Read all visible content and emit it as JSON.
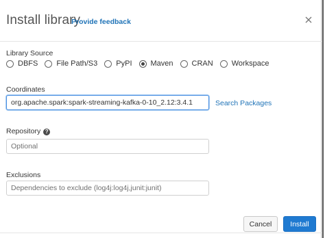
{
  "dialog": {
    "title": "Install library",
    "feedback_link": "Provide feedback",
    "close_icon": "close-icon"
  },
  "library_source": {
    "label": "Library Source",
    "options": [
      "DBFS",
      "File Path/S3",
      "PyPI",
      "Maven",
      "CRAN",
      "Workspace"
    ],
    "selected": "Maven"
  },
  "coordinates": {
    "label": "Coordinates",
    "value": "org.apache.spark:spark-streaming-kafka-0-10_2.12:3.4.1",
    "search_link": "Search Packages"
  },
  "repository": {
    "label": "Repository",
    "help_icon": "help-icon",
    "placeholder": "Optional"
  },
  "exclusions": {
    "label": "Exclusions",
    "placeholder": "Dependencies to exclude (log4j:log4j,junit:junit)"
  },
  "footer": {
    "cancel_label": "Cancel",
    "install_label": "Install"
  },
  "colors": {
    "link": "#1f73b7",
    "primary_button": "#1f7ad1",
    "focus_border": "#4a90e2"
  }
}
